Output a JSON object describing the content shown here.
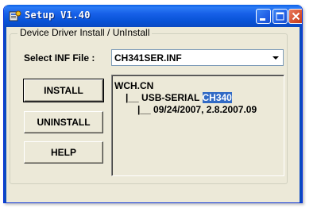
{
  "window": {
    "title": "Setup V1.40",
    "title_icon": "setup-app-icon",
    "controls": {
      "minimize_icon": "minimize-icon",
      "maximize_icon": "maximize-icon",
      "close_icon": "close-icon"
    },
    "colors": {
      "titlebar": "#0a5fe6",
      "face": "#ece9d8",
      "close": "#d5502f",
      "highlight": "#316ac5"
    }
  },
  "group": {
    "legend": "Device Driver Install / UnInstall"
  },
  "inf": {
    "label": "Select INF File :",
    "selected": "CH341SER.INF",
    "dropdown_icon": "chevron-down-icon"
  },
  "buttons": {
    "install": "INSTALL",
    "uninstall": "UNINSTALL",
    "help": "HELP"
  },
  "tree": {
    "line1": "WCH.CN",
    "line2_prefix": "|__ USB-SERIAL ",
    "line2_highlight": "CH340",
    "line3": "|__ 09/24/2007, 2.8.2007.09"
  }
}
